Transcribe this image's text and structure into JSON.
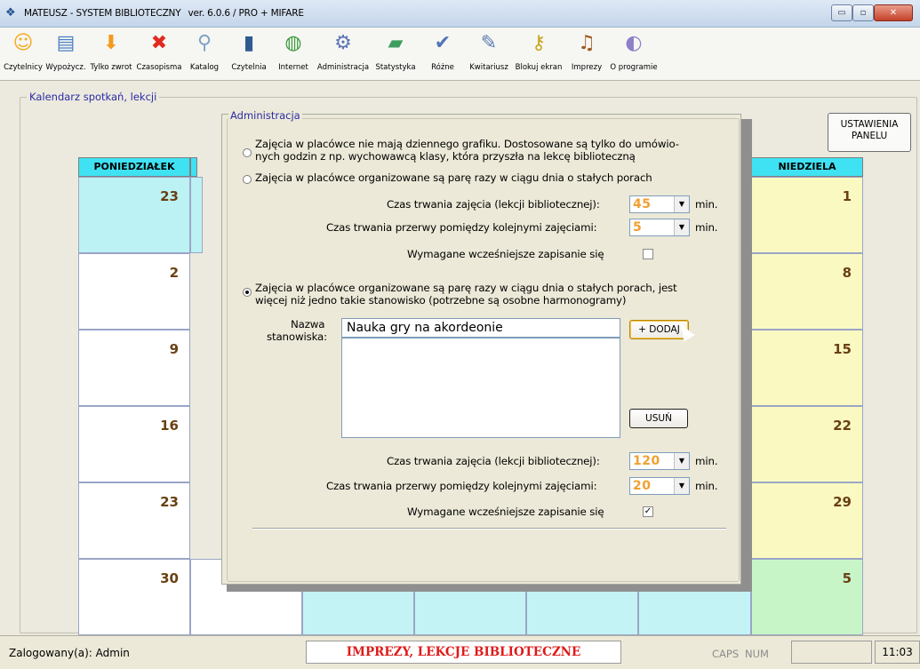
{
  "window": {
    "title": "MATEUSZ - SYSTEM BIBLIOTECZNY",
    "version": "ver. 6.0.6 / PRO + MIFARE",
    "controls": {
      "minimize": "▭",
      "maximize": "▫",
      "close": "✕"
    }
  },
  "toolbar": {
    "items": [
      {
        "label": "Czytelnicy",
        "icon": "smiley-icon",
        "glyph": "☺",
        "color": "#f6a81f"
      },
      {
        "label": "Wypożycz.",
        "icon": "book-stack-icon",
        "glyph": "▤",
        "color": "#4d7fc4"
      },
      {
        "label": "Tylko zwrot",
        "icon": "return-arrow-icon",
        "glyph": "⬇",
        "color": "#f39a1f"
      },
      {
        "label": "Czasopisma",
        "icon": "cross-icon",
        "glyph": "✖",
        "color": "#e02a1f"
      },
      {
        "label": "Katalog",
        "icon": "magnifier-icon",
        "glyph": "⚲",
        "color": "#7fa3c8"
      },
      {
        "label": "Czytelnia",
        "icon": "book-icon",
        "glyph": "▮",
        "color": "#2f5c8e"
      },
      {
        "label": "Internet",
        "icon": "globe-icon",
        "glyph": "◍",
        "color": "#3a9a3a"
      },
      {
        "label": "Administracja",
        "icon": "gears-icon",
        "glyph": "⚙",
        "color": "#5c76b5"
      },
      {
        "label": "Statystyka",
        "icon": "chart-icon",
        "glyph": "▰",
        "color": "#3f9c5f"
      },
      {
        "label": "Różne",
        "icon": "calendar-check-icon",
        "glyph": "✔",
        "color": "#4f74b8"
      },
      {
        "label": "Kwitariusz",
        "icon": "receipt-icon",
        "glyph": "✎",
        "color": "#5a7ab0"
      },
      {
        "label": "Blokuj ekran",
        "icon": "padlock-icon",
        "glyph": "⚷",
        "color": "#c9a520"
      },
      {
        "label": "Imprezy",
        "icon": "guitar-icon",
        "glyph": "♫",
        "color": "#a05a1f"
      },
      {
        "label": "O programie",
        "icon": "lightbulb-icon",
        "glyph": "◐",
        "color": "#8e7fc8"
      }
    ]
  },
  "panel": {
    "title": "Kalendarz spotkań, lekcji",
    "settings_button": [
      "USTAWIENIA",
      "PANELU"
    ]
  },
  "calendar": {
    "headers": [
      "PONIEDZIAŁEK",
      "NIEDZIELA"
    ],
    "monday": [
      "23",
      "2",
      "9",
      "16",
      "23",
      "30"
    ],
    "sunday": [
      "1",
      "8",
      "15",
      "22",
      "29",
      "5"
    ],
    "colors": {
      "monday_first": "#bdf2f5",
      "sunday": "#fbf9c2",
      "last_row": "#c4f3f6",
      "sunday_last": "#c8f5c8",
      "header": "#3fe2f2",
      "header_sun": "#f7f6b0"
    }
  },
  "dialog": {
    "title": "Administracja",
    "option1": [
      "Zajęcia w placówce nie mają dziennego grafiku. Dostosowane są tylko do umówio-",
      "nych godzin z np. wychowawcą klasy, która przyszła na lekcę biblioteczną"
    ],
    "option2": "Zajęcia w placówce organizowane są parę razy w ciągu dnia o stałych porach",
    "opt2_duration_label": "Czas trwania zajęcia (lekcji bibliotecznej):",
    "opt2_duration_value": "45",
    "opt2_break_label": "Czas trwania przerwy pomiędzy kolejnymi zajęciami:",
    "opt2_break_value": "5",
    "unit": "min.",
    "opt2_signup_label": "Wymagane wcześniejsze zapisanie się",
    "option3": [
      "Zajęcia w placówce organizowane są parę razy w ciągu dnia o stałych porach, jest",
      "więcej niż jedno takie stanowisko (potrzebne są osobne harmonogramy)"
    ],
    "station_label": [
      "Nazwa",
      "stanowiska:"
    ],
    "station_value": "Nauka gry na akordeonie",
    "add_button": "+ DODAJ",
    "remove_button": "USUŃ",
    "opt3_duration_label": "Czas trwania zajęcia (lekcji bibliotecznej):",
    "opt3_duration_value": "120",
    "opt3_break_label": "Czas trwania przerwy pomiędzy kolejnymi zajęciami:",
    "opt3_break_value": "20",
    "opt3_signup_label": "Wymagane wcześniejsze zapisanie się",
    "opt3_signup_checked": "✓",
    "dropdown_arrow": "▼",
    "selected_option": 3
  },
  "status": {
    "user": "Zalogowany(a): Admin",
    "module": "IMPREZY, LEKCJE BIBLIOTECZNE",
    "caps": "CAPS",
    "num": "NUM",
    "time": "11:03"
  }
}
